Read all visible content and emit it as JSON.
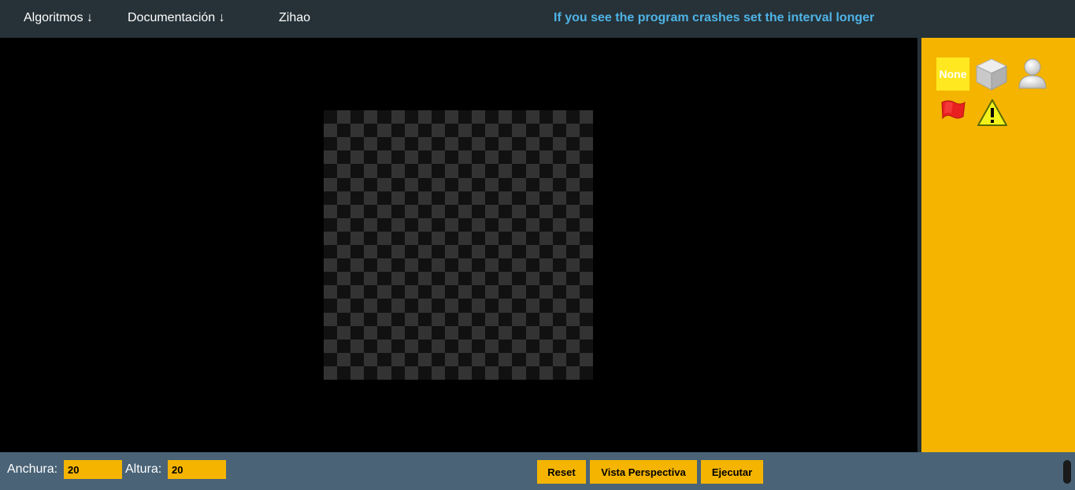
{
  "nav": {
    "items": [
      {
        "label": "Algoritmos ↓"
      },
      {
        "label": "Documentación ↓"
      },
      {
        "label": "Zihao"
      }
    ],
    "notice": "If you see the program crashes set the interval longer"
  },
  "board": {
    "rows": 20,
    "cols": 20,
    "colors": {
      "dark": "#111111",
      "light": "#333333"
    }
  },
  "sidebar": {
    "tools": [
      {
        "name": "none",
        "label": "None"
      },
      {
        "name": "wall-block-icon"
      },
      {
        "name": "player-icon"
      },
      {
        "name": "flag-icon"
      },
      {
        "name": "warning-icon"
      }
    ],
    "background": "#f4b400"
  },
  "controls": {
    "width_label": "Anchura:",
    "width_value": "20",
    "height_label": "Altura:",
    "height_value": "20",
    "reset_label": "Reset",
    "perspective_label": "Vista Perspectiva",
    "run_label": "Ejecutar"
  },
  "colors": {
    "topbar": "#263238",
    "bottombar": "#4a6377",
    "accent": "#f4b400",
    "notice": "#4fb3e6"
  }
}
